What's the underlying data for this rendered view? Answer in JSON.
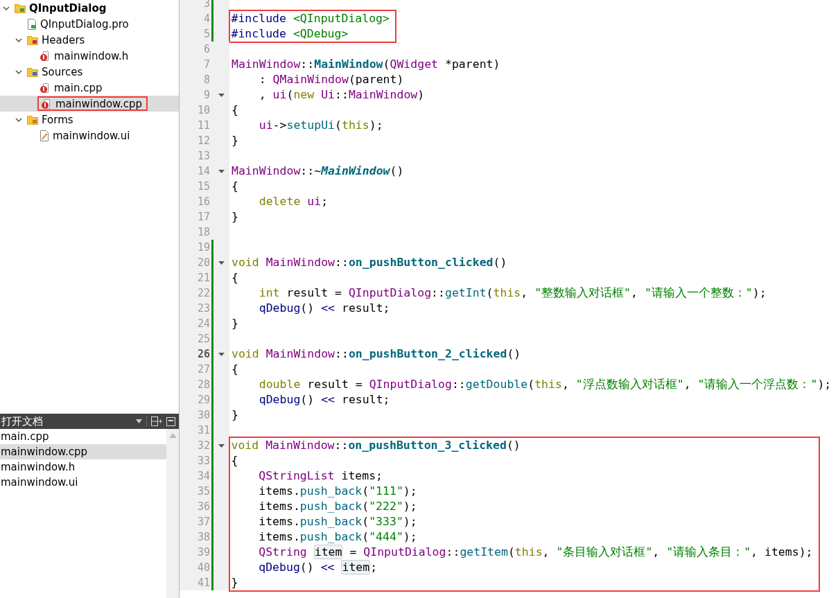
{
  "project_tree": [
    {
      "label": "QInputDialog",
      "kind": "project",
      "expanded": true,
      "selected": false,
      "highlighted": false,
      "children": [
        {
          "label": "QInputDialog.pro",
          "kind": "pro",
          "selected": false,
          "highlighted": false
        },
        {
          "label": "Headers",
          "kind": "header_folder",
          "expanded": true,
          "selected": false,
          "highlighted": false,
          "children": [
            {
              "label": "mainwindow.h",
              "kind": "header",
              "selected": false,
              "highlighted": false
            }
          ]
        },
        {
          "label": "Sources",
          "kind": "source_folder",
          "expanded": true,
          "selected": false,
          "highlighted": false,
          "children": [
            {
              "label": "main.cpp",
              "kind": "source",
              "selected": false,
              "highlighted": false
            },
            {
              "label": "mainwindow.cpp",
              "kind": "source",
              "selected": true,
              "highlighted": true
            }
          ]
        },
        {
          "label": "Forms",
          "kind": "form_folder",
          "expanded": true,
          "selected": false,
          "highlighted": false,
          "children": [
            {
              "label": "mainwindow.ui",
              "kind": "form",
              "selected": false,
              "highlighted": false
            }
          ]
        }
      ]
    }
  ],
  "open_documents": {
    "title": "打开文档",
    "items": [
      {
        "label": "main.cpp",
        "selected": false
      },
      {
        "label": "mainwindow.cpp",
        "selected": true
      },
      {
        "label": "mainwindow.h",
        "selected": false
      },
      {
        "label": "mainwindow.ui",
        "selected": false
      }
    ]
  },
  "editor": {
    "blocks": [
      {
        "highlighted": false,
        "lines": [
          {
            "number": "3",
            "modified": true,
            "foldable": false,
            "current": false
          }
        ]
      },
      {
        "highlighted": true,
        "lines": [
          {
            "number": "4",
            "modified": true,
            "foldable": false,
            "current": false,
            "tokens": [
              {
                "kind": "pre",
                "text": "#include "
              },
              {
                "kind": "str",
                "text": "<QInputDialog>"
              }
            ]
          },
          {
            "number": "5",
            "modified": true,
            "foldable": false,
            "current": false,
            "tokens": [
              {
                "kind": "pre",
                "text": "#include "
              },
              {
                "kind": "str",
                "text": "<QDebug>"
              }
            ]
          }
        ]
      },
      {
        "highlighted": false,
        "lines": [
          {
            "number": "6",
            "modified": false,
            "foldable": false,
            "current": false
          },
          {
            "number": "7",
            "modified": false,
            "foldable": false,
            "current": false,
            "tokens": [
              {
                "kind": "type",
                "text": "MainWindow"
              },
              {
                "kind": "plain",
                "text": "::"
              },
              {
                "kind": "fndef",
                "text": "MainWindow"
              },
              {
                "kind": "plain",
                "text": "("
              },
              {
                "kind": "type",
                "text": "QWidget"
              },
              {
                "kind": "plain",
                "text": " *parent)"
              }
            ]
          },
          {
            "number": "8",
            "modified": false,
            "foldable": false,
            "current": false,
            "tokens": [
              {
                "kind": "plain",
                "text": "    : "
              },
              {
                "kind": "type",
                "text": "QMainWindow"
              },
              {
                "kind": "plain",
                "text": "(parent)"
              }
            ]
          },
          {
            "number": "9",
            "modified": false,
            "foldable": true,
            "current": false,
            "tokens": [
              {
                "kind": "plain",
                "text": "    , "
              },
              {
                "kind": "type",
                "text": "ui"
              },
              {
                "kind": "plain",
                "text": "("
              },
              {
                "kind": "keyword",
                "text": "new "
              },
              {
                "kind": "type",
                "text": "Ui"
              },
              {
                "kind": "plain",
                "text": "::"
              },
              {
                "kind": "type",
                "text": "MainWindow"
              },
              {
                "kind": "plain",
                "text": ")"
              }
            ]
          },
          {
            "number": "10",
            "modified": false,
            "foldable": false,
            "current": false,
            "tokens": [
              {
                "kind": "plain",
                "text": "{"
              }
            ]
          },
          {
            "number": "11",
            "modified": false,
            "foldable": false,
            "current": false,
            "tokens": [
              {
                "kind": "type",
                "text": "    ui"
              },
              {
                "kind": "plain",
                "text": "->"
              },
              {
                "kind": "fn",
                "text": "setupUi"
              },
              {
                "kind": "plain",
                "text": "("
              },
              {
                "kind": "keyword",
                "text": "this"
              },
              {
                "kind": "plain",
                "text": ");"
              }
            ]
          },
          {
            "number": "12",
            "modified": false,
            "foldable": false,
            "current": false,
            "tokens": [
              {
                "kind": "plain",
                "text": "}"
              }
            ]
          },
          {
            "number": "13",
            "modified": false,
            "foldable": false,
            "current": false
          },
          {
            "number": "14",
            "modified": false,
            "foldable": true,
            "current": false,
            "tokens": [
              {
                "kind": "type",
                "text": "MainWindow"
              },
              {
                "kind": "plain",
                "text": "::~"
              },
              {
                "kind": "virt",
                "text": "MainWindow"
              },
              {
                "kind": "plain",
                "text": "()"
              }
            ]
          },
          {
            "number": "15",
            "modified": false,
            "foldable": false,
            "current": false,
            "tokens": [
              {
                "kind": "plain",
                "text": "{"
              }
            ]
          },
          {
            "number": "16",
            "modified": false,
            "foldable": false,
            "current": false,
            "tokens": [
              {
                "kind": "keyword",
                "text": "    delete "
              },
              {
                "kind": "type",
                "text": "ui"
              },
              {
                "kind": "plain",
                "text": ";"
              }
            ]
          },
          {
            "number": "17",
            "modified": false,
            "foldable": false,
            "current": false,
            "tokens": [
              {
                "kind": "plain",
                "text": "}"
              }
            ]
          },
          {
            "number": "18",
            "modified": false,
            "foldable": false,
            "current": false
          },
          {
            "number": "19",
            "modified": true,
            "foldable": false,
            "current": false
          },
          {
            "number": "20",
            "modified": true,
            "foldable": true,
            "current": false,
            "tokens": [
              {
                "kind": "keyword",
                "text": "void "
              },
              {
                "kind": "type",
                "text": "MainWindow"
              },
              {
                "kind": "plain",
                "text": "::"
              },
              {
                "kind": "fndef",
                "text": "on_pushButton_clicked"
              },
              {
                "kind": "plain",
                "text": "()"
              }
            ]
          },
          {
            "number": "21",
            "modified": true,
            "foldable": false,
            "current": false,
            "tokens": [
              {
                "kind": "plain",
                "text": "{"
              }
            ]
          },
          {
            "number": "22",
            "modified": true,
            "foldable": false,
            "current": false,
            "tokens": [
              {
                "kind": "keyword",
                "text": "    int"
              },
              {
                "kind": "plain",
                "text": " result = "
              },
              {
                "kind": "type",
                "text": "QInputDialog"
              },
              {
                "kind": "plain",
                "text": "::"
              },
              {
                "kind": "fn",
                "text": "getInt"
              },
              {
                "kind": "plain",
                "text": "("
              },
              {
                "kind": "keyword",
                "text": "this"
              },
              {
                "kind": "plain",
                "text": ", "
              },
              {
                "kind": "str",
                "text": "\"整数输入对话框\""
              },
              {
                "kind": "plain",
                "text": ", "
              },
              {
                "kind": "str",
                "text": "\"请输入一个整数：\""
              },
              {
                "kind": "plain",
                "text": ");"
              }
            ]
          },
          {
            "number": "23",
            "modified": true,
            "foldable": false,
            "current": false,
            "tokens": [
              {
                "kind": "op",
                "text": "    qDebug"
              },
              {
                "kind": "plain",
                "text": "() "
              },
              {
                "kind": "op",
                "text": "<<"
              },
              {
                "kind": "plain",
                "text": " result;"
              }
            ]
          },
          {
            "number": "24",
            "modified": true,
            "foldable": false,
            "current": false,
            "tokens": [
              {
                "kind": "plain",
                "text": "}"
              }
            ]
          },
          {
            "number": "25",
            "modified": true,
            "foldable": false,
            "current": false
          },
          {
            "number": "26",
            "modified": true,
            "foldable": true,
            "current": true,
            "tokens": [
              {
                "kind": "keyword",
                "text": "void "
              },
              {
                "kind": "type",
                "text": "MainWindow"
              },
              {
                "kind": "plain",
                "text": "::"
              },
              {
                "kind": "fndef",
                "text": "on_pushButton_2_clicked"
              },
              {
                "kind": "plain",
                "text": "()"
              }
            ]
          },
          {
            "number": "27",
            "modified": true,
            "foldable": false,
            "current": false,
            "tokens": [
              {
                "kind": "plain",
                "text": "{"
              }
            ]
          },
          {
            "number": "28",
            "modified": true,
            "foldable": false,
            "current": false,
            "tokens": [
              {
                "kind": "keyword",
                "text": "    double"
              },
              {
                "kind": "plain",
                "text": " result = "
              },
              {
                "kind": "type",
                "text": "QInputDialog"
              },
              {
                "kind": "plain",
                "text": "::"
              },
              {
                "kind": "fn",
                "text": "getDouble"
              },
              {
                "kind": "plain",
                "text": "("
              },
              {
                "kind": "keyword",
                "text": "this"
              },
              {
                "kind": "plain",
                "text": ", "
              },
              {
                "kind": "str",
                "text": "\"浮点数输入对话框\""
              },
              {
                "kind": "plain",
                "text": ", "
              },
              {
                "kind": "str",
                "text": "\"请输入一个浮点数：\""
              },
              {
                "kind": "plain",
                "text": ");"
              }
            ]
          },
          {
            "number": "29",
            "modified": true,
            "foldable": false,
            "current": false,
            "tokens": [
              {
                "kind": "op",
                "text": "    qDebug"
              },
              {
                "kind": "plain",
                "text": "() "
              },
              {
                "kind": "op",
                "text": "<<"
              },
              {
                "kind": "plain",
                "text": " result;"
              }
            ]
          },
          {
            "number": "30",
            "modified": true,
            "foldable": false,
            "current": false,
            "tokens": [
              {
                "kind": "plain",
                "text": "}"
              }
            ]
          },
          {
            "number": "31",
            "modified": true,
            "foldable": false,
            "current": false
          }
        ]
      },
      {
        "highlighted": true,
        "lines": [
          {
            "number": "32",
            "modified": true,
            "foldable": true,
            "current": false,
            "tokens": [
              {
                "kind": "keyword",
                "text": "void "
              },
              {
                "kind": "type",
                "text": "MainWindow"
              },
              {
                "kind": "plain",
                "text": "::"
              },
              {
                "kind": "fndef",
                "text": "on_pushButton_3_clicked"
              },
              {
                "kind": "plain",
                "text": "()"
              }
            ]
          },
          {
            "number": "33",
            "modified": true,
            "foldable": false,
            "current": false,
            "tokens": [
              {
                "kind": "plain",
                "text": "{"
              }
            ]
          },
          {
            "number": "34",
            "modified": true,
            "foldable": false,
            "current": false,
            "tokens": [
              {
                "kind": "type",
                "text": "    QStringList"
              },
              {
                "kind": "plain",
                "text": " items;"
              }
            ]
          },
          {
            "number": "35",
            "modified": true,
            "foldable": false,
            "current": false,
            "tokens": [
              {
                "kind": "plain",
                "text": "    items."
              },
              {
                "kind": "fn",
                "text": "push_back"
              },
              {
                "kind": "plain",
                "text": "("
              },
              {
                "kind": "str",
                "text": "\"111\""
              },
              {
                "kind": "plain",
                "text": ");"
              }
            ]
          },
          {
            "number": "36",
            "modified": true,
            "foldable": false,
            "current": false,
            "tokens": [
              {
                "kind": "plain",
                "text": "    items."
              },
              {
                "kind": "fn",
                "text": "push_back"
              },
              {
                "kind": "plain",
                "text": "("
              },
              {
                "kind": "str",
                "text": "\"222\""
              },
              {
                "kind": "plain",
                "text": ");"
              }
            ]
          },
          {
            "number": "37",
            "modified": true,
            "foldable": false,
            "current": false,
            "tokens": [
              {
                "kind": "plain",
                "text": "    items."
              },
              {
                "kind": "fn",
                "text": "push_back"
              },
              {
                "kind": "plain",
                "text": "("
              },
              {
                "kind": "str",
                "text": "\"333\""
              },
              {
                "kind": "plain",
                "text": ");"
              }
            ]
          },
          {
            "number": "38",
            "modified": true,
            "foldable": false,
            "current": false,
            "tokens": [
              {
                "kind": "plain",
                "text": "    items."
              },
              {
                "kind": "fn",
                "text": "push_back"
              },
              {
                "kind": "plain",
                "text": "("
              },
              {
                "kind": "str",
                "text": "\"444\""
              },
              {
                "kind": "plain",
                "text": ");"
              }
            ]
          },
          {
            "number": "39",
            "modified": true,
            "foldable": false,
            "current": false,
            "tokens": [
              {
                "kind": "type",
                "text": "    QString "
              },
              {
                "kind": "occurrence",
                "text": "item"
              },
              {
                "kind": "plain",
                "text": " = "
              },
              {
                "kind": "type",
                "text": "QInputDialog"
              },
              {
                "kind": "plain",
                "text": "::"
              },
              {
                "kind": "fn",
                "text": "getItem"
              },
              {
                "kind": "plain",
                "text": "("
              },
              {
                "kind": "keyword",
                "text": "this"
              },
              {
                "kind": "plain",
                "text": ", "
              },
              {
                "kind": "str",
                "text": "\"条目输入对话框\""
              },
              {
                "kind": "plain",
                "text": ", "
              },
              {
                "kind": "str",
                "text": "\"请输入条目：\""
              },
              {
                "kind": "plain",
                "text": ", items);"
              }
            ]
          },
          {
            "number": "40",
            "modified": true,
            "foldable": false,
            "current": false,
            "tokens": [
              {
                "kind": "op",
                "text": "    qDebug"
              },
              {
                "kind": "plain",
                "text": "() "
              },
              {
                "kind": "op",
                "text": "<< "
              },
              {
                "kind": "occurrence",
                "text": "item"
              },
              {
                "kind": "plain",
                "text": ";"
              }
            ]
          },
          {
            "number": "41",
            "modified": true,
            "foldable": false,
            "current": false,
            "tokens": [
              {
                "kind": "plain",
                "text": "}"
              }
            ]
          }
        ]
      }
    ]
  }
}
